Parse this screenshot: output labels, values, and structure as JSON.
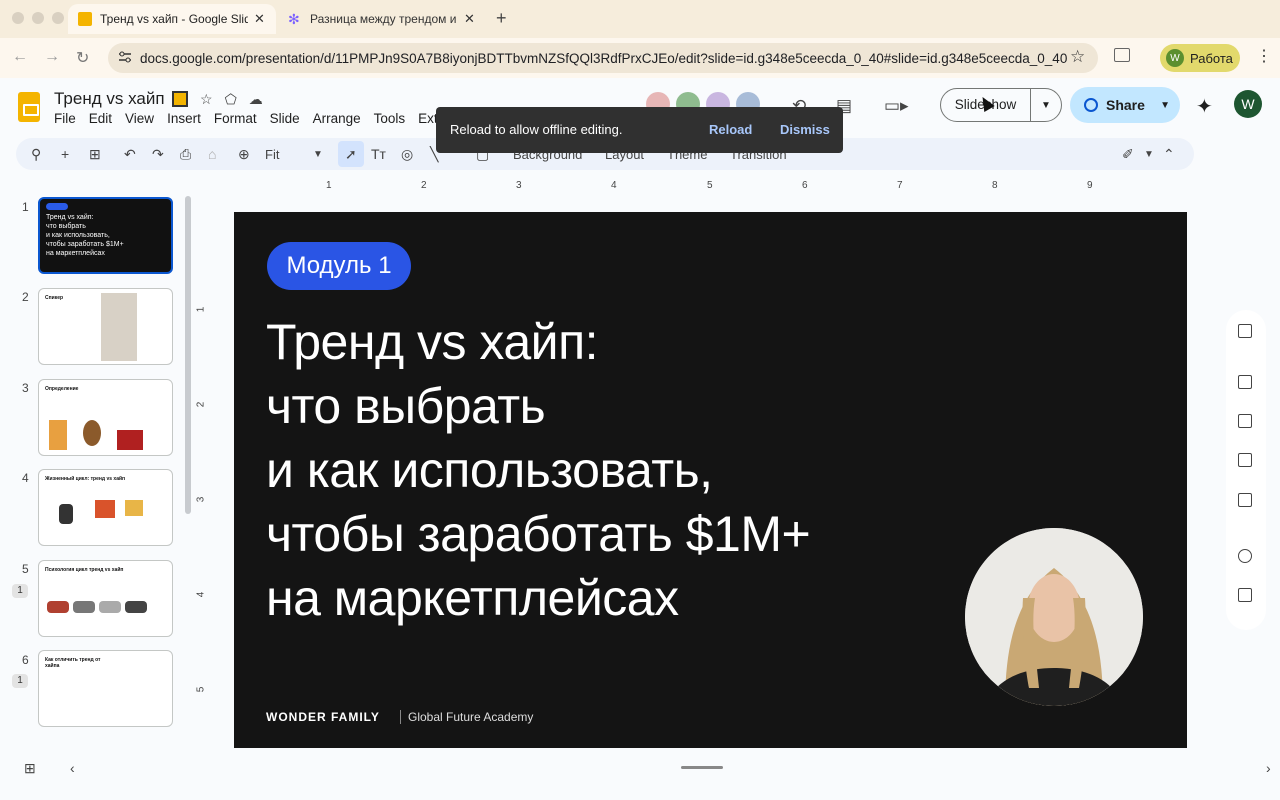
{
  "browser": {
    "tabs": [
      {
        "title": "Тренд vs хайп - Google Slides",
        "favicon": "google-slides-icon",
        "color": "#f4b400"
      },
      {
        "title": "Разница между трендом и хайпом",
        "favicon": "assistant-icon",
        "color": "#7b61ff"
      }
    ],
    "url": "docs.google.com/presentation/d/11PMPJn9S0A7B8iyonjBDTTbvmNZSfQQl3RdfPrxCJEo/edit?slide=id.g348e5ceecda_0_40#slide=id.g348e5ceecda_0_40",
    "profile_label": "Работа",
    "profile_initial": "W"
  },
  "app": {
    "doc_title": "Тренд vs хайп",
    "menu": [
      "File",
      "Edit",
      "View",
      "Insert",
      "Format",
      "Slide",
      "Arrange",
      "Tools",
      "Ext"
    ],
    "slideshow_label": "Slideshow",
    "share_label": "Share",
    "user_initial": "W",
    "collaborators": [
      "#e7b6b6",
      "#8fbc8f",
      "#c9b6e0",
      "#a8bcd8"
    ],
    "accent": "#0b57d0"
  },
  "toolbar": {
    "zoom": "Fit",
    "background": "Background",
    "layout": "Layout",
    "theme": "Theme",
    "transition": "Transition"
  },
  "toast": {
    "message": "Reload to allow offline editing.",
    "reload": "Reload",
    "dismiss": "Dismiss"
  },
  "ruler": {
    "h": [
      "1",
      "2",
      "3",
      "4",
      "5",
      "6",
      "7",
      "8",
      "9"
    ],
    "v": [
      "1",
      "2",
      "3",
      "4",
      "5"
    ]
  },
  "thumbnails": [
    {
      "num": "1",
      "title": "Тренд vs хайп:\nчто выбрать\nи как использовать,\nчтобы заработать $1M+\nна маркетплейсах",
      "badge": ""
    },
    {
      "num": "2",
      "title": "Спикер",
      "badge": ""
    },
    {
      "num": "3",
      "title": "Определение",
      "badge": ""
    },
    {
      "num": "4",
      "title": "Жизненный цикл: тренд vs хайп",
      "badge": ""
    },
    {
      "num": "5",
      "title": "Психология цикл тренд vs хайп",
      "badge": "1"
    },
    {
      "num": "6",
      "title": "Как отличить тренд от хайпа",
      "badge": "1"
    }
  ],
  "slide": {
    "module": "Модуль 1",
    "headline": "Тренд vs хайп:\nчто выбрать\nи как использовать,\nчтобы заработать $1M+\nна маркетплейсах",
    "brand": "WONDER FAMILY",
    "academy": "Global Future Academy",
    "background": "#141414",
    "module_color": "#2a55e5"
  }
}
